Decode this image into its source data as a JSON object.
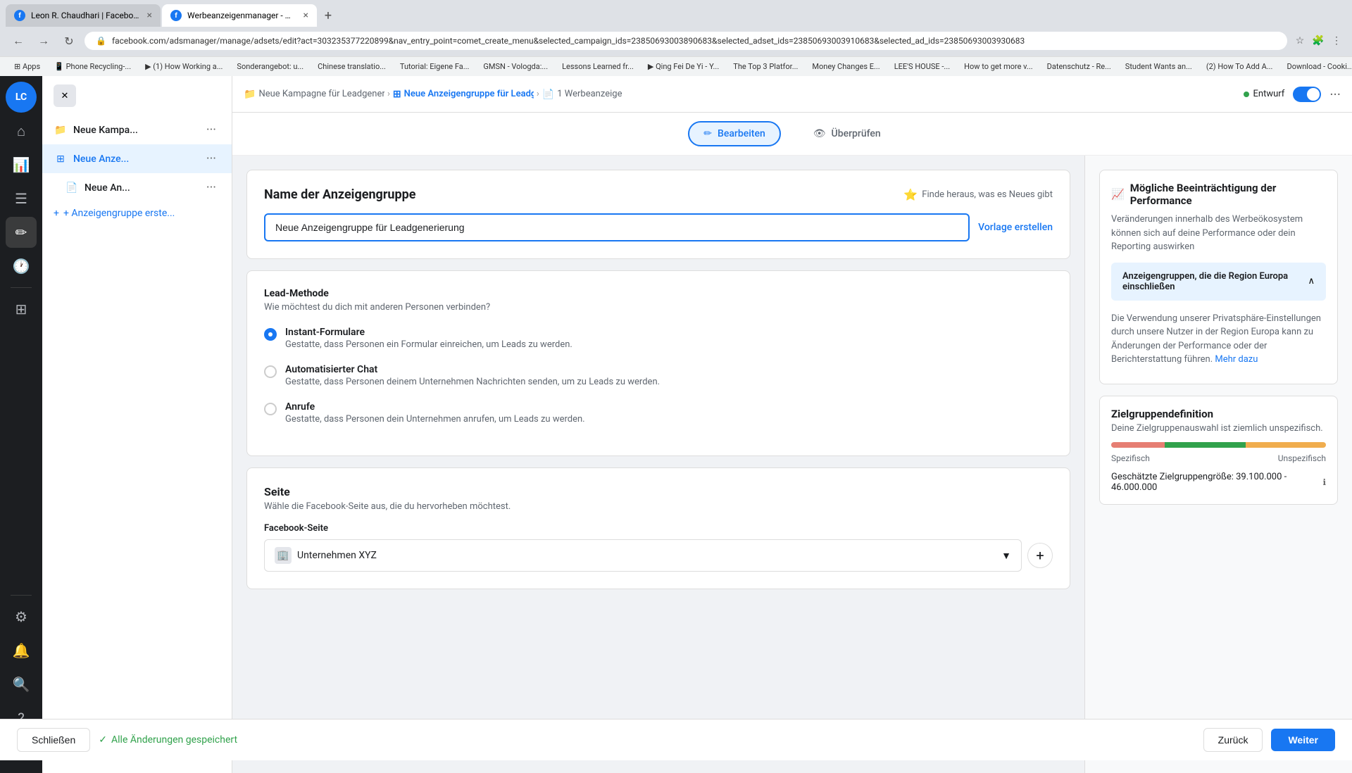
{
  "browser": {
    "tabs": [
      {
        "id": "tab1",
        "title": "Leon R. Chaudhari | Facebook",
        "active": false,
        "favicon": "F"
      },
      {
        "id": "tab2",
        "title": "Werbeanzeigenmanager - Wer...",
        "active": true,
        "favicon": "f"
      }
    ],
    "url": "facebook.com/adsmanager/manage/adsets/edit?act=303235377220899&nav_entry_point=comet_create_menu&selected_campaign_ids=23850693003890683&selected_adset_ids=23850693003910683&selected_ad_ids=23850693003930683",
    "bookmarks": [
      "Apps",
      "Phone Recycling-...",
      "(1) How Working a...",
      "Sonderangebot: u...",
      "Chinese translatio...",
      "Tutorial: Eigene Fa...",
      "GMSN - Vologda:...",
      "Lessons Learned fr...",
      "Qing Fei De Yi - Y...",
      "The Top 3 Platfor...",
      "Money Changes E...",
      "LEE'S HOUSE -...",
      "How to get more v...",
      "Datenschutz - Re...",
      "Student Wants an...",
      "(2) How To Add A...",
      "Download - Cooki..."
    ]
  },
  "icon_sidebar": {
    "home_icon": "⌂",
    "chart_icon": "📊",
    "menu_icon": "☰",
    "edit_icon": "✏",
    "clock_icon": "🕐",
    "grid_icon": "⊞",
    "gear_icon": "⚙",
    "bell_icon": "🔔",
    "search_icon": "🔍",
    "help_icon": "?",
    "table_icon": "▤"
  },
  "campaign_sidebar": {
    "items": [
      {
        "id": "campaign",
        "icon": "📁",
        "label": "Neue Kampa...",
        "type": "folder"
      },
      {
        "id": "adset",
        "icon": "⊞",
        "label": "Neue Anze...",
        "type": "grid"
      },
      {
        "id": "ad",
        "icon": "📄",
        "label": "Neue An...",
        "type": "doc"
      }
    ],
    "add_label": "+ Anzeigengruppe erste..."
  },
  "breadcrumb": {
    "campaign": "Neue Kampagne für Leadgenerier...",
    "adset": "Neue Anzeigengruppe für Leadgen...",
    "ad": "1 Werbeanzeige",
    "status": "Entwurf"
  },
  "edit_review": {
    "edit_label": "Bearbeiten",
    "review_label": "Überprüfen"
  },
  "form": {
    "ad_group_name_section": {
      "title": "Name der Anzeigengruppe",
      "find_out_label": "Finde heraus, was es Neues gibt",
      "name_value": "Neue Anzeigengruppe für Leadgenerierung",
      "template_label": "Vorlage erstellen"
    },
    "lead_method_section": {
      "title": "Lead-Methode",
      "description": "Wie möchtest du dich mit anderen Personen verbinden?",
      "options": [
        {
          "id": "instant_forms",
          "label": "Instant-Formulare",
          "description": "Gestatte, dass Personen ein Formular einreichen, um Leads zu werden.",
          "selected": true
        },
        {
          "id": "auto_chat",
          "label": "Automatisierter Chat",
          "description": "Gestatte, dass Personen deinem Unternehmen Nachrichten senden, um zu Leads zu werden.",
          "selected": false
        },
        {
          "id": "calls",
          "label": "Anrufe",
          "description": "Gestatte, dass Personen dein Unternehmen anrufen, um Leads zu werden.",
          "selected": false
        }
      ]
    },
    "page_section": {
      "title": "Seite",
      "description": "Wähle die Facebook-Seite aus, die du hervorheben möchtest.",
      "fb_page_label": "Facebook-Seite",
      "page_value": "Unternehmen XYZ"
    }
  },
  "right_panel": {
    "performance_section": {
      "icon": "📈",
      "title": "Mögliche Beeinträchtigung der Performance",
      "text": "Veränderungen innerhalb des Werbeökosystem können sich auf deine Performance oder dein Reporting auswirken"
    },
    "eu_section": {
      "title": "Anzeigengruppen, die die Region Europa einschließen",
      "text": "Die Verwendung unserer Privatsphäre-Einstellungen durch unsere Nutzer in der Region Europa kann zu Änderungen der Performance oder der Berichterstattung führen.",
      "link_label": "Mehr dazu"
    },
    "audience_section": {
      "title": "Zielgruppendefinition",
      "desc": "Deine Zielgruppenauswahl ist ziemlich unspezifisch.",
      "label_specific": "Spezifisch",
      "label_unspecific": "Unspezifisch",
      "size_label": "Geschätzte Zielgruppengröße: 39.100.000 - 46.000.000"
    }
  },
  "bottom_bar": {
    "close_label": "Schließen",
    "saved_label": "Alle Änderungen gespeichert",
    "back_label": "Zurück",
    "next_label": "Weiter"
  }
}
